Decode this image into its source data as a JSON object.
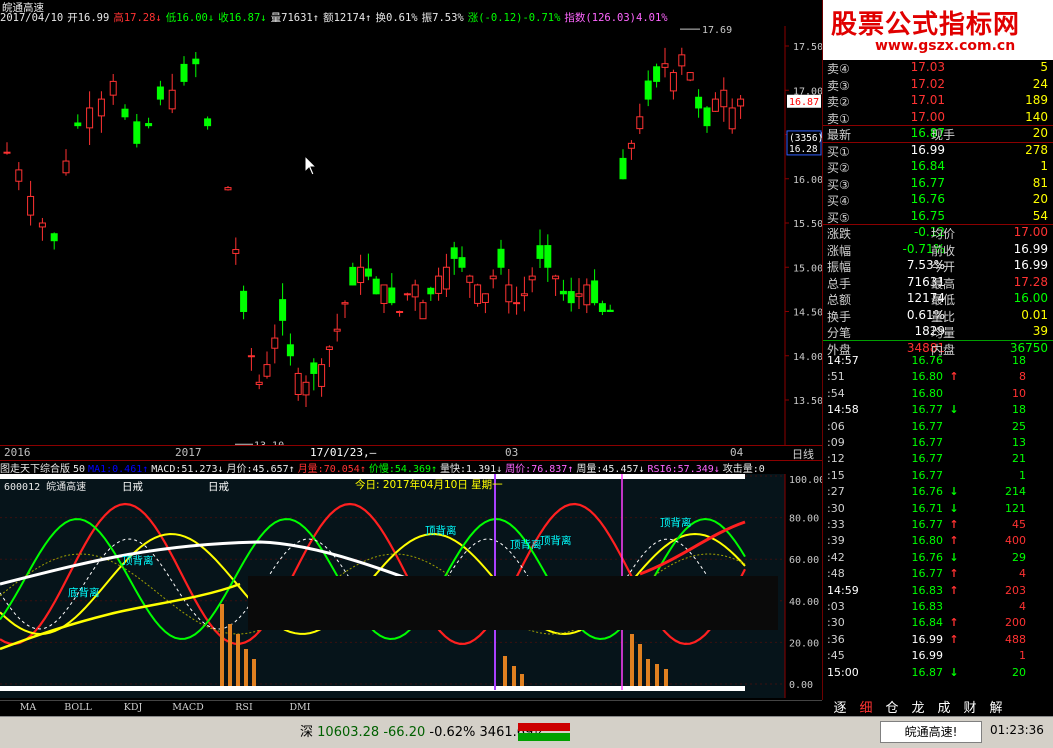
{
  "stock": {
    "name": "皖通高速",
    "code_name": "600012 皖通高速",
    "info_bar": [
      {
        "text": "2017/04/10",
        "color": "#e8e8e8"
      },
      {
        "text": "开16.99",
        "color": "#e8e8e8"
      },
      {
        "text": "高17.28↓",
        "color": "#ff3232"
      },
      {
        "text": "低16.00↓",
        "color": "#00ff00"
      },
      {
        "text": "收16.87↓",
        "color": "#00ff00"
      },
      {
        "text": "量71631↑",
        "color": "#e8e8e8"
      },
      {
        "text": "额12174↑",
        "color": "#e8e8e8"
      },
      {
        "text": "换0.61%",
        "color": "#e8e8e8"
      },
      {
        "text": "振7.53%",
        "color": "#e8e8e8"
      },
      {
        "text": "涨(-0.12)-0.71%",
        "color": "#00ff00"
      },
      {
        "text": "指数(126.03)4.01%",
        "color": "#ff66ff"
      }
    ]
  },
  "price_axis": {
    "labels": [
      "17.50",
      "17.00",
      "16.50",
      "16.00",
      "15.50",
      "15.00",
      "14.50",
      "14.00",
      "13.50"
    ],
    "current_tag": "16.87",
    "secondary_tag_top": "(3356)",
    "secondary_tag_bottom": "16.28",
    "high_label": "17.69",
    "low_label": "13.10"
  },
  "time_axis": {
    "labels": [
      "2016",
      "2017",
      "17/01/23,—",
      "03",
      "04"
    ],
    "period": "日线"
  },
  "indicator_bar": [
    {
      "text": "图走天下综合版",
      "color": "#e8e8e8"
    },
    {
      "text": "50",
      "color": "#e8e8e8"
    },
    {
      "text": "MA1:0.461↑",
      "color": "#0000ff"
    },
    {
      "text": "MACD:51.273↓",
      "color": "#e8e8e8"
    },
    {
      "text": "月价:45.657↑",
      "color": "#e8e8e8"
    },
    {
      "text": "月量:70.054↑",
      "color": "#ff3232"
    },
    {
      "text": "价慢:54.369↑",
      "color": "#00ff00"
    },
    {
      "text": "量快:1.391↓",
      "color": "#e8e8e8"
    },
    {
      "text": "周价:76.837↑",
      "color": "#ff66ff"
    },
    {
      "text": "周量:45.457↓",
      "color": "#e8e8e8"
    },
    {
      "text": "RSI6:57.349↓",
      "color": "#ff66ff"
    },
    {
      "text": "攻击量:0",
      "color": "#e8e8e8"
    }
  ],
  "indicator": {
    "axis_labels": [
      "100.00",
      "80.00",
      "60.00",
      "40.00",
      "20.00",
      "0.00"
    ],
    "annotations": [
      {
        "text": "日戒",
        "color": "#ffffff"
      },
      {
        "text": "日戒",
        "color": "#ffffff"
      },
      {
        "text": "今日: 2017年04月10日 星期一",
        "color": "#ffff00"
      },
      {
        "text": "顶背离",
        "color": "#00ffff"
      },
      {
        "text": "顶背离",
        "color": "#00ffff"
      },
      {
        "text": "顶背离",
        "color": "#00ffff"
      },
      {
        "text": "顶背离",
        "color": "#00ffff"
      },
      {
        "text": "顶背离",
        "color": "#00ffff"
      },
      {
        "text": "底背离",
        "color": "#00ffff"
      }
    ]
  },
  "bottom_tabs": [
    "MA",
    "BOLL",
    "KDJ",
    "MACD",
    "RSI",
    "DMI"
  ],
  "watermark": {
    "title": "股票公式指标网",
    "url": "www.gszx.com.cn"
  },
  "order_book": {
    "sells": [
      {
        "label": "卖④",
        "price": "17.03",
        "vol": "5"
      },
      {
        "label": "卖③",
        "price": "17.02",
        "vol": "24"
      },
      {
        "label": "卖②",
        "price": "17.01",
        "vol": "189"
      },
      {
        "label": "卖①",
        "price": "17.00",
        "vol": "140"
      }
    ],
    "latest": {
      "label": "最新",
      "price": "16.87",
      "label2": "现手",
      "value2": "20"
    },
    "buys": [
      {
        "label": "买①",
        "price": "16.99",
        "vol": "278",
        "price_color": "#ffffff"
      },
      {
        "label": "买②",
        "price": "16.84",
        "vol": "1",
        "price_color": "#00ff00"
      },
      {
        "label": "买③",
        "price": "16.77",
        "vol": "81",
        "price_color": "#00ff00"
      },
      {
        "label": "买④",
        "price": "16.76",
        "vol": "20",
        "price_color": "#00ff00"
      },
      {
        "label": "买⑤",
        "price": "16.75",
        "vol": "54",
        "price_color": "#00ff00"
      }
    ],
    "stats": [
      {
        "l1": "涨跌",
        "v1": "-0.12",
        "c1": "#00ff00",
        "l2": "均价",
        "v2": "17.00",
        "c2": "#ff3232"
      },
      {
        "l1": "涨幅",
        "v1": "-0.71%",
        "c1": "#00ff00",
        "l2": "前收",
        "v2": "16.99",
        "c2": "#ffffff"
      },
      {
        "l1": "振幅",
        "v1": "7.53%",
        "c1": "#ffffff",
        "l2": "今开",
        "v2": "16.99",
        "c2": "#ffffff"
      },
      {
        "l1": "总手",
        "v1": "71631",
        "c1": "#ffffff",
        "l2": "最高",
        "v2": "17.28",
        "c2": "#ff3232"
      },
      {
        "l1": "总额",
        "v1": "12174",
        "c1": "#ffffff",
        "l2": "最低",
        "v2": "16.00",
        "c2": "#00ff00"
      },
      {
        "l1": "换手",
        "v1": "0.61%",
        "c1": "#ffffff",
        "l2": "量比",
        "v2": "0.01",
        "c2": "#ffff00"
      },
      {
        "l1": "分笔",
        "v1": "1829",
        "c1": "#ffffff",
        "l2": "均量",
        "v2": "39",
        "c2": "#ffff00"
      }
    ],
    "outer": {
      "label": "外盘",
      "value": "34881",
      "label2": "内盘",
      "value2": "36750"
    }
  },
  "ticks": [
    {
      "time": "14:57",
      "price": "16.76",
      "arrow": "",
      "qty": "18",
      "pc": "#00ff00",
      "qc": "#00ff00"
    },
    {
      "time": ":51",
      "price": "16.80",
      "arrow": "↑",
      "qty": "8",
      "pc": "#00ff00",
      "qc": "#ff3232"
    },
    {
      "time": ":54",
      "price": "16.80",
      "arrow": "",
      "qty": "10",
      "pc": "#00ff00",
      "qc": "#ff3232"
    },
    {
      "time": "14:58",
      "price": "16.77",
      "arrow": "↓",
      "qty": "18",
      "pc": "#00ff00",
      "qc": "#00ff00"
    },
    {
      "time": ":06",
      "price": "16.77",
      "arrow": "",
      "qty": "25",
      "pc": "#00ff00",
      "qc": "#00ff00"
    },
    {
      "time": ":09",
      "price": "16.77",
      "arrow": "",
      "qty": "13",
      "pc": "#00ff00",
      "qc": "#00ff00"
    },
    {
      "time": ":12",
      "price": "16.77",
      "arrow": "",
      "qty": "21",
      "pc": "#00ff00",
      "qc": "#00ff00"
    },
    {
      "time": ":15",
      "price": "16.77",
      "arrow": "",
      "qty": "1",
      "pc": "#00ff00",
      "qc": "#00ff00"
    },
    {
      "time": ":27",
      "price": "16.76",
      "arrow": "↓",
      "qty": "214",
      "pc": "#00ff00",
      "qc": "#00ff00"
    },
    {
      "time": ":30",
      "price": "16.71",
      "arrow": "↓",
      "qty": "121",
      "pc": "#00ff00",
      "qc": "#00ff00"
    },
    {
      "time": ":33",
      "price": "16.77",
      "arrow": "↑",
      "qty": "45",
      "pc": "#00ff00",
      "qc": "#ff3232"
    },
    {
      "time": ":39",
      "price": "16.80",
      "arrow": "↑",
      "qty": "400",
      "pc": "#00ff00",
      "qc": "#ff3232"
    },
    {
      "time": ":42",
      "price": "16.76",
      "arrow": "↓",
      "qty": "29",
      "pc": "#00ff00",
      "qc": "#00ff00"
    },
    {
      "time": ":48",
      "price": "16.77",
      "arrow": "↑",
      "qty": "4",
      "pc": "#00ff00",
      "qc": "#ff3232"
    },
    {
      "time": "14:59",
      "price": "16.83",
      "arrow": "↑",
      "qty": "203",
      "pc": "#00ff00",
      "qc": "#ff3232"
    },
    {
      "time": ":03",
      "price": "16.83",
      "arrow": "",
      "qty": "4",
      "pc": "#00ff00",
      "qc": "#ff3232"
    },
    {
      "time": ":30",
      "price": "16.84",
      "arrow": "↑",
      "qty": "200",
      "pc": "#00ff00",
      "qc": "#ff3232"
    },
    {
      "time": ":36",
      "price": "16.99",
      "arrow": "↑",
      "qty": "488",
      "pc": "#ffffff",
      "qc": "#ff3232"
    },
    {
      "time": ":45",
      "price": "16.99",
      "arrow": "",
      "qty": "1",
      "pc": "#ffffff",
      "qc": "#ff3232"
    },
    {
      "time": "15:00",
      "price": "16.87",
      "arrow": "↓",
      "qty": "20",
      "pc": "#00ff00",
      "qc": "#00ff00"
    }
  ],
  "right_tabs": [
    "逐",
    "细",
    "仓",
    "龙",
    "成",
    "财",
    "解"
  ],
  "status": {
    "index_name": "深",
    "index_value": "10603.28",
    "index_change": "-66.20",
    "index_pct": "-0.62%",
    "index_amount": "3461.69亿",
    "stock_tag": "皖通高速!",
    "time": "01:23:36"
  }
}
